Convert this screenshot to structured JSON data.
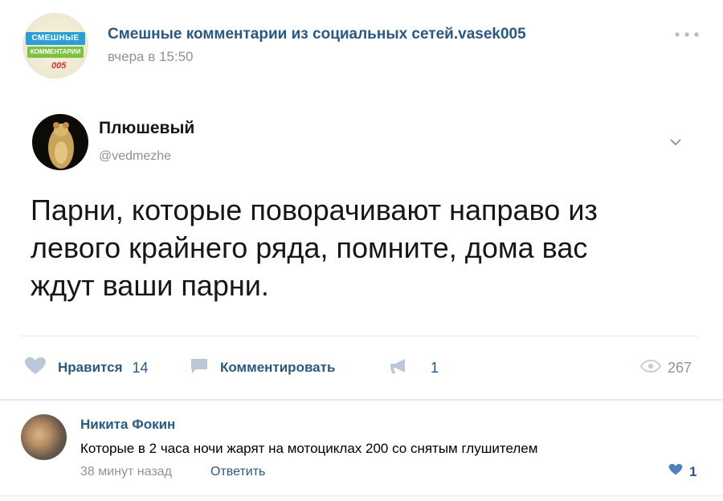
{
  "post": {
    "group_name": "Смешные комментарии из социальных сетей.vasek005",
    "time": "вчера в 15:50",
    "group_logo": {
      "line1": "СМЕШНЫЕ",
      "line2": "КОММЕНТАРИИ",
      "line3": "005"
    },
    "more_icon": "more-horizontal-icon"
  },
  "tweet": {
    "author_name": "Плюшевый",
    "author_handle": "@vedmezhe",
    "text": "Парни, которые поворачивают направо из\nлевого крайнего ряда,  помните, дома вас\nждут ваши парни."
  },
  "actions": {
    "like_label": "Нравится",
    "like_count": "14",
    "comment_label": "Комментировать",
    "share_count": "1",
    "views_count": "267"
  },
  "comment": {
    "author": "Никита Фокин",
    "text": "Которые в 2 часа ночи жарят на мотоциклах 200 со снятым глушителем",
    "time": "38 минут назад",
    "reply_label": "Ответить",
    "like_count": "1"
  },
  "colors": {
    "link": "#2a5885",
    "muted": "#939393",
    "icon": "#bcc8d8",
    "like_icon": "#5181b8"
  }
}
